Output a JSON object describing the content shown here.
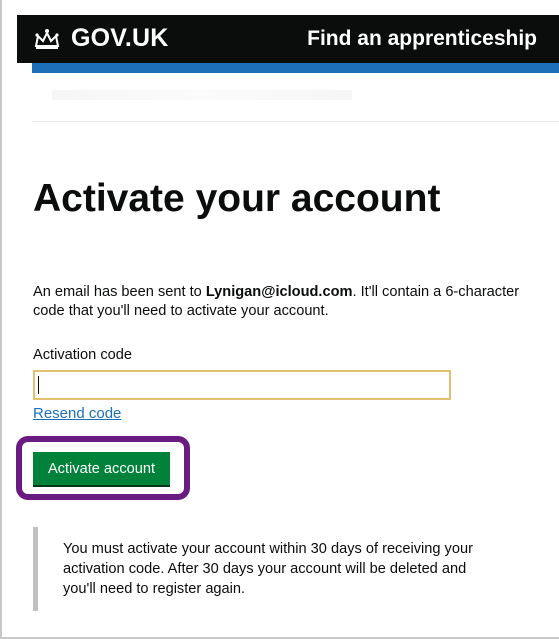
{
  "header": {
    "logo_text": "GOV.UK",
    "service_name": "Find an apprenticeship"
  },
  "page": {
    "title": "Activate your account",
    "lead_prefix": "An email has been sent to ",
    "email": "Lynigan@icloud.com",
    "lead_suffix": ". It'll contain a 6-character code that you'll need to activate your account."
  },
  "form": {
    "label": "Activation code",
    "value": "",
    "resend_link": "Resend code",
    "submit_label": "Activate account"
  },
  "inset": {
    "text": "You must activate your account within 30 days of receiving your activation code. After 30 days your account will be deleted and you'll need to register again."
  },
  "colors": {
    "header_bg": "#0b0c0c",
    "accent_blue": "#1d70b8",
    "button_green": "#00823b",
    "focus_yellow": "#e3c06f",
    "highlight_purple": "#6a1b80"
  },
  "icons": {
    "logo": "crown-icon"
  }
}
